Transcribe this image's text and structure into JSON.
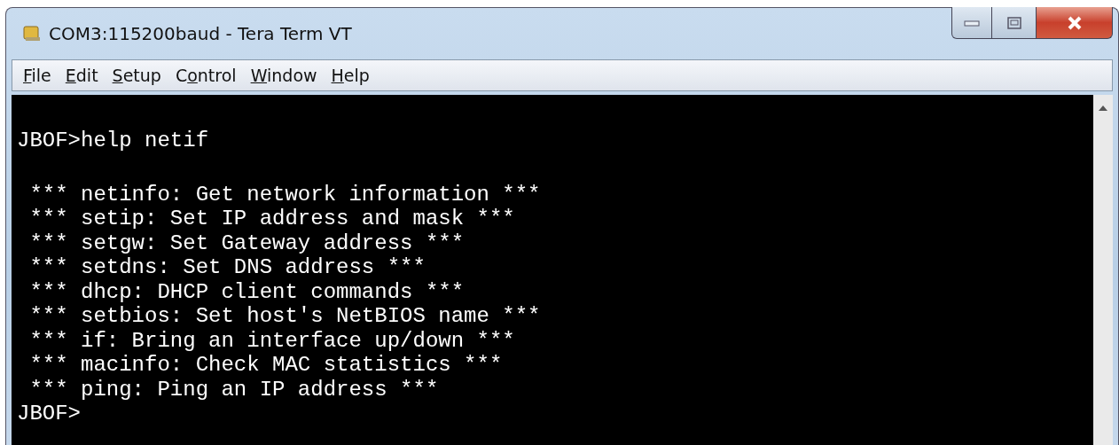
{
  "window": {
    "title": "COM3:115200baud - Tera Term VT"
  },
  "menu": [
    {
      "key": "F",
      "post": "ile"
    },
    {
      "key": "E",
      "post": "dit"
    },
    {
      "key": "S",
      "post": "etup"
    },
    {
      "pre": "C",
      "key": "o",
      "post": "ntrol"
    },
    {
      "key": "W",
      "post": "indow"
    },
    {
      "key": "H",
      "post": "elp"
    }
  ],
  "terminal": {
    "lines": [
      {
        "kind": "command",
        "text": "JBOF>help netif"
      },
      {
        "kind": "output",
        "text": " *** netinfo: Get network information ***"
      },
      {
        "kind": "output",
        "text": " *** setip: Set IP address and mask ***"
      },
      {
        "kind": "output",
        "text": " *** setgw: Set Gateway address ***"
      },
      {
        "kind": "output",
        "text": " *** setdns: Set DNS address ***"
      },
      {
        "kind": "output",
        "text": " *** dhcp: DHCP client commands ***"
      },
      {
        "kind": "output",
        "text": " *** setbios: Set host's NetBIOS name ***"
      },
      {
        "kind": "output",
        "text": " *** if: Bring an interface up/down ***"
      },
      {
        "kind": "output",
        "text": " *** macinfo: Check MAC statistics ***"
      },
      {
        "kind": "output",
        "text": " *** ping: Ping an IP address ***"
      },
      {
        "kind": "prompt",
        "text": "JBOF>"
      }
    ]
  }
}
